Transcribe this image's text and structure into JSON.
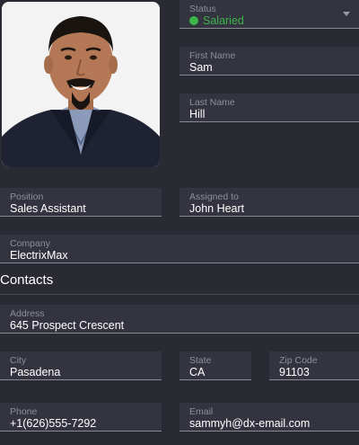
{
  "profile": {
    "photo_alt": "employee-photo"
  },
  "status": {
    "label": "Status",
    "value": "Salaried",
    "color": "#3cb54a"
  },
  "first_name": {
    "label": "First Name",
    "value": "Sam"
  },
  "last_name": {
    "label": "Last Name",
    "value": "Hill"
  },
  "position": {
    "label": "Position",
    "value": "Sales Assistant"
  },
  "assigned_to": {
    "label": "Assigned to",
    "value": "John Heart"
  },
  "company": {
    "label": "Company",
    "value": "ElectrixMax"
  },
  "contacts": {
    "title": "Contacts",
    "address": {
      "label": "Address",
      "value": "645 Prospect Crescent"
    },
    "city": {
      "label": "City",
      "value": "Pasadena"
    },
    "state": {
      "label": "State",
      "value": "CA"
    },
    "zip": {
      "label": "Zip Code",
      "value": "91103"
    },
    "phone": {
      "label": "Phone",
      "value": "+1(626)555-7292"
    },
    "email": {
      "label": "Email",
      "value": "sammyh@dx-email.com"
    }
  },
  "colors": {
    "background": "#2a2a33",
    "field_bg": "#343440",
    "label": "#8f8f99",
    "accent_green": "#3cb54a"
  }
}
